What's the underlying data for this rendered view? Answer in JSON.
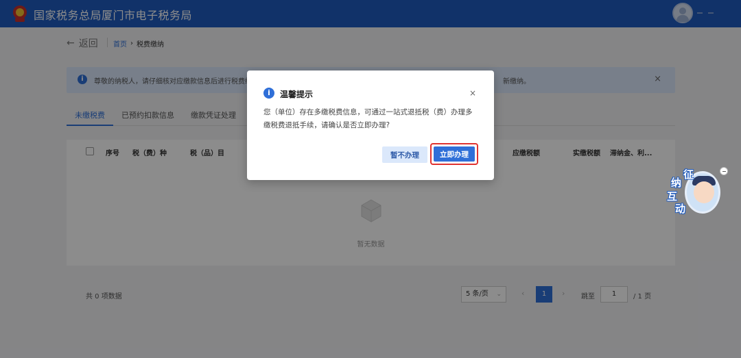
{
  "header": {
    "title": "国家税务总局厦门市电子税务局"
  },
  "breadcrumb": {
    "back_label": "返回",
    "home": "首页",
    "current": "税费缴纳"
  },
  "notice": {
    "text_left": "尊敬的纳税人，请仔细核对应缴款信息后进行税费缴纳",
    "text_right": "新缴纳。"
  },
  "tabs": [
    {
      "label": "未缴税费",
      "active": true
    },
    {
      "label": "已预约扣款信息",
      "active": false
    },
    {
      "label": "缴款凭证处理",
      "active": false
    }
  ],
  "table": {
    "columns": [
      "序号",
      "税（费）种",
      "税（品）目",
      "应缴税额",
      "实缴税额",
      "滞纳金、利..."
    ],
    "empty_text": "暂无数据"
  },
  "pagination": {
    "total": "共 0 项数据",
    "page_size": "5 条/页",
    "current_page": "1",
    "goto_label": "跳至",
    "goto_value": "1",
    "total_pages": "/ 1 页"
  },
  "modal": {
    "title": "温馨提示",
    "body": "您（单位）存在多缴税费信息，可通过一站式退抵税（费）办理多缴税费退抵手续，请确认是否立即办理?",
    "cancel_label": "暂不办理",
    "confirm_label": "立即办理",
    "close_symbol": "×"
  },
  "assistant": {
    "chars": [
      "征",
      "纳",
      "互",
      "动"
    ]
  },
  "colors": {
    "header_bg": "#1f5bbf",
    "primary": "#2f6fd8",
    "highlight_border": "#e0322f"
  }
}
